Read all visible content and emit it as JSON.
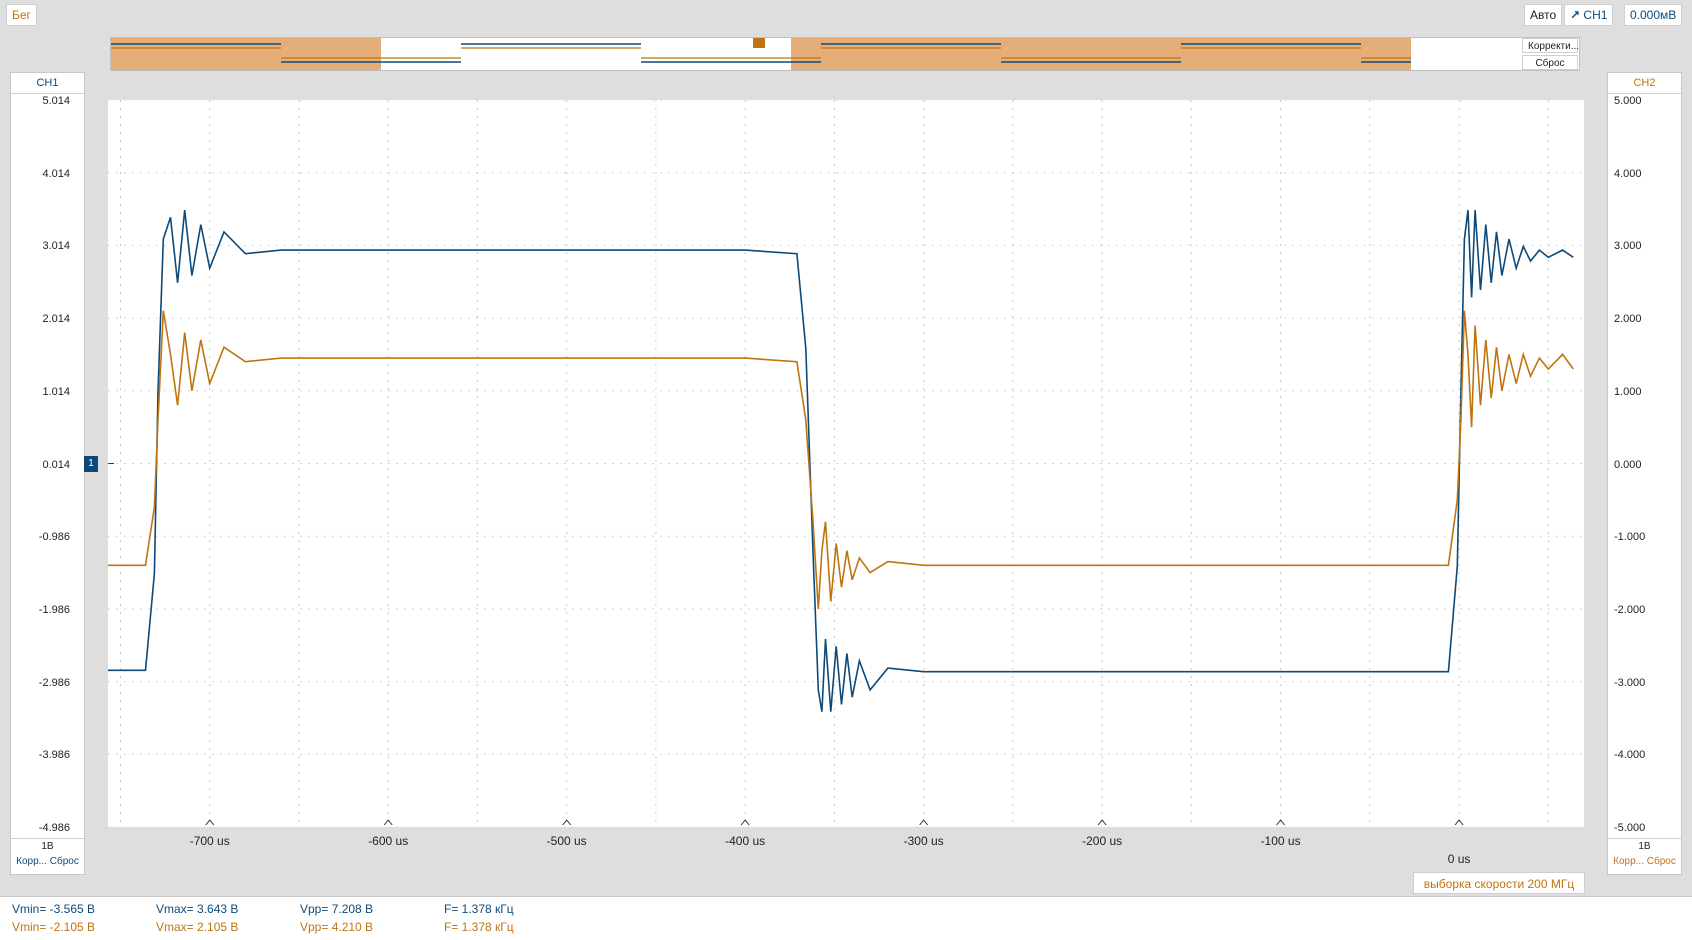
{
  "toolbar": {
    "run_state": "Бег",
    "trigger_mode": "Авто",
    "trigger_source": "CH1",
    "trigger_level": "0.000мВ"
  },
  "overview": {
    "auto_set_button": "Корректи...",
    "reset_button": "Сброс"
  },
  "ch1": {
    "title": "CH1",
    "scale": "1В",
    "auto_label": "Корр...",
    "reset_label": "Сброс",
    "ticks": [
      "5.014",
      "4.014",
      "3.014",
      "2.014",
      "1.014",
      "0.014",
      "-0.986",
      "-1.986",
      "-2.986",
      "-3.986",
      "-4.986"
    ],
    "marker": "1"
  },
  "ch2": {
    "title": "CH2",
    "scale": "1В",
    "auto_label": "Корр...",
    "reset_label": "Сброс",
    "ticks": [
      "5.000",
      "4.000",
      "3.000",
      "2.000",
      "1.000",
      "0.000",
      "-1.000",
      "-2.000",
      "-3.000",
      "-4.000",
      "-5.000"
    ]
  },
  "time_axis": {
    "labels": [
      "-700 us",
      "-600 us",
      "-500 us",
      "-400 us",
      "-300 us",
      "-200 us",
      "-100 us",
      "0 us"
    ]
  },
  "trigger_marker": "T",
  "sample_rate": "выборка скорости 200 МГц",
  "measurements": {
    "ch1": {
      "vmin": "Vmin= -3.565 В",
      "vmax": "Vmax= 3.643 В",
      "vpp": "Vpp= 7.208 В",
      "freq": "F= 1.378 кГц"
    },
    "ch2": {
      "vmin": "Vmin= -2.105 В",
      "vmax": "Vmax= 2.105 В",
      "vpp": "Vpp= 4.210 В",
      "freq": "F= 1.378 кГц"
    }
  },
  "colors": {
    "ch1": "#0d4a7a",
    "ch2": "#c07410"
  },
  "chart_data": {
    "type": "line",
    "xlabel": "",
    "ylabel": "",
    "xlim": [
      -757,
      70
    ],
    "ylim_ch1": [
      -4.986,
      5.014
    ],
    "ylim_ch2": [
      -5.0,
      5.0
    ],
    "grid": true,
    "series": [
      {
        "name": "CH1",
        "x": [
          -757,
          -736,
          -731,
          -729,
          -726,
          -722,
          -718,
          -714,
          -710,
          -705,
          -700,
          -692,
          -680,
          -660,
          -400,
          -371,
          -366,
          -362,
          -359,
          -357,
          -355,
          -352,
          -349,
          -346,
          -343,
          -340,
          -336,
          -330,
          -320,
          -300,
          -100,
          -6,
          -1,
          1,
          3,
          5,
          7,
          9,
          12,
          15,
          18,
          21,
          24,
          28,
          32,
          36,
          40,
          45,
          50,
          58,
          64
        ],
        "values": [
          -2.83,
          -2.83,
          -1.5,
          1.0,
          3.1,
          3.4,
          2.5,
          3.5,
          2.6,
          3.3,
          2.7,
          3.2,
          2.9,
          2.95,
          2.95,
          2.9,
          1.6,
          -1.2,
          -3.1,
          -3.4,
          -2.4,
          -3.4,
          -2.5,
          -3.3,
          -2.6,
          -3.2,
          -2.7,
          -3.1,
          -2.8,
          -2.85,
          -2.85,
          -2.85,
          -1.4,
          1.0,
          3.1,
          3.5,
          2.3,
          3.5,
          2.4,
          3.3,
          2.5,
          3.2,
          2.6,
          3.1,
          2.7,
          3.0,
          2.8,
          2.95,
          2.85,
          2.95,
          2.85
        ]
      },
      {
        "name": "CH2",
        "x": [
          -757,
          -736,
          -731,
          -729,
          -726,
          -722,
          -718,
          -714,
          -710,
          -705,
          -700,
          -692,
          -680,
          -660,
          -400,
          -371,
          -366,
          -362,
          -359,
          -357,
          -355,
          -352,
          -349,
          -346,
          -343,
          -340,
          -336,
          -330,
          -320,
          -300,
          -100,
          -6,
          -1,
          1,
          3,
          5,
          7,
          9,
          12,
          15,
          18,
          21,
          24,
          28,
          32,
          36,
          40,
          45,
          50,
          58,
          64
        ],
        "values": [
          -1.4,
          -1.4,
          -0.6,
          0.6,
          2.1,
          1.5,
          0.8,
          1.8,
          1.0,
          1.7,
          1.1,
          1.6,
          1.4,
          1.45,
          1.45,
          1.4,
          0.6,
          -0.8,
          -2.0,
          -1.2,
          -0.8,
          -1.9,
          -1.1,
          -1.7,
          -1.2,
          -1.6,
          -1.3,
          -1.5,
          -1.35,
          -1.4,
          -1.4,
          -1.4,
          -0.5,
          0.6,
          2.1,
          1.5,
          0.5,
          1.9,
          0.8,
          1.7,
          0.9,
          1.6,
          1.0,
          1.5,
          1.1,
          1.5,
          1.2,
          1.45,
          1.3,
          1.5,
          1.3
        ]
      }
    ]
  }
}
